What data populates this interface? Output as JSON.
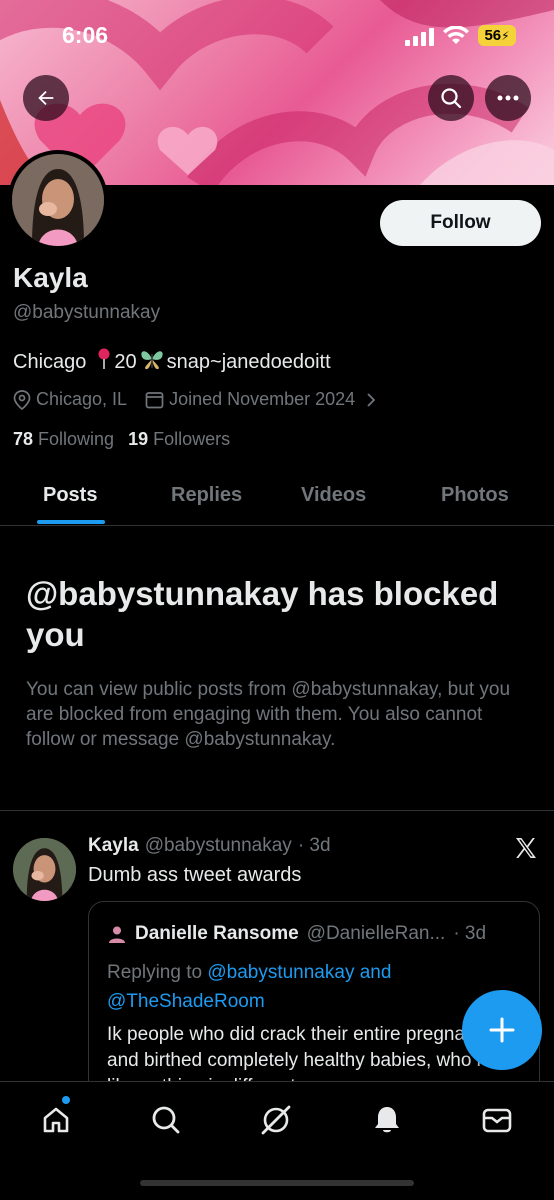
{
  "status_bar": {
    "time": "6:06",
    "battery": "56"
  },
  "profile": {
    "name": "Kayla",
    "handle": "@babystunnakay",
    "bio_city": "Chicago",
    "bio_age": "20",
    "bio_snap": "snap~janedoedoitt",
    "location": "Chicago, IL",
    "joined": "Joined November 2024",
    "following_count": "78",
    "following_label": "Following",
    "followers_count": "19",
    "followers_label": "Followers",
    "follow_button": "Follow"
  },
  "tabs": [
    {
      "label": "Posts",
      "active": true
    },
    {
      "label": "Replies",
      "active": false
    },
    {
      "label": "Videos",
      "active": false
    },
    {
      "label": "Photos",
      "active": false
    }
  ],
  "blocked": {
    "title": "@babystunnakay has blocked you",
    "description": "You can view public posts from @babystunnakay, but you are blocked from engaging with them. You also cannot follow or message @babystunnakay."
  },
  "tweet": {
    "name": "Kayla",
    "handle": "@babystunnakay",
    "time": "· 3d",
    "text": "Dumb ass tweet awards",
    "quote": {
      "name": "Danielle Ransome",
      "handle": "@DanielleRan...",
      "time": "· 3d",
      "replying_prefix": "Replying to",
      "replying_user1": "@babystunnakay",
      "replying_and": "and",
      "replying_user2": "@TheShadeRoom",
      "body": "Ik people who did crack their entire pregnancies and birthed completely healthy babies, who look like nothing is different."
    }
  },
  "colors": {
    "accent": "#1d9bf0",
    "background": "#000000",
    "muted": "#71767b"
  },
  "icons": [
    "back-arrow-icon",
    "search-icon",
    "more-icon",
    "location-pin-icon",
    "calendar-icon",
    "chevron-right-icon",
    "x-logo-icon",
    "plus-icon",
    "home-icon",
    "explore-icon",
    "grok-icon",
    "bell-icon",
    "mail-icon"
  ]
}
